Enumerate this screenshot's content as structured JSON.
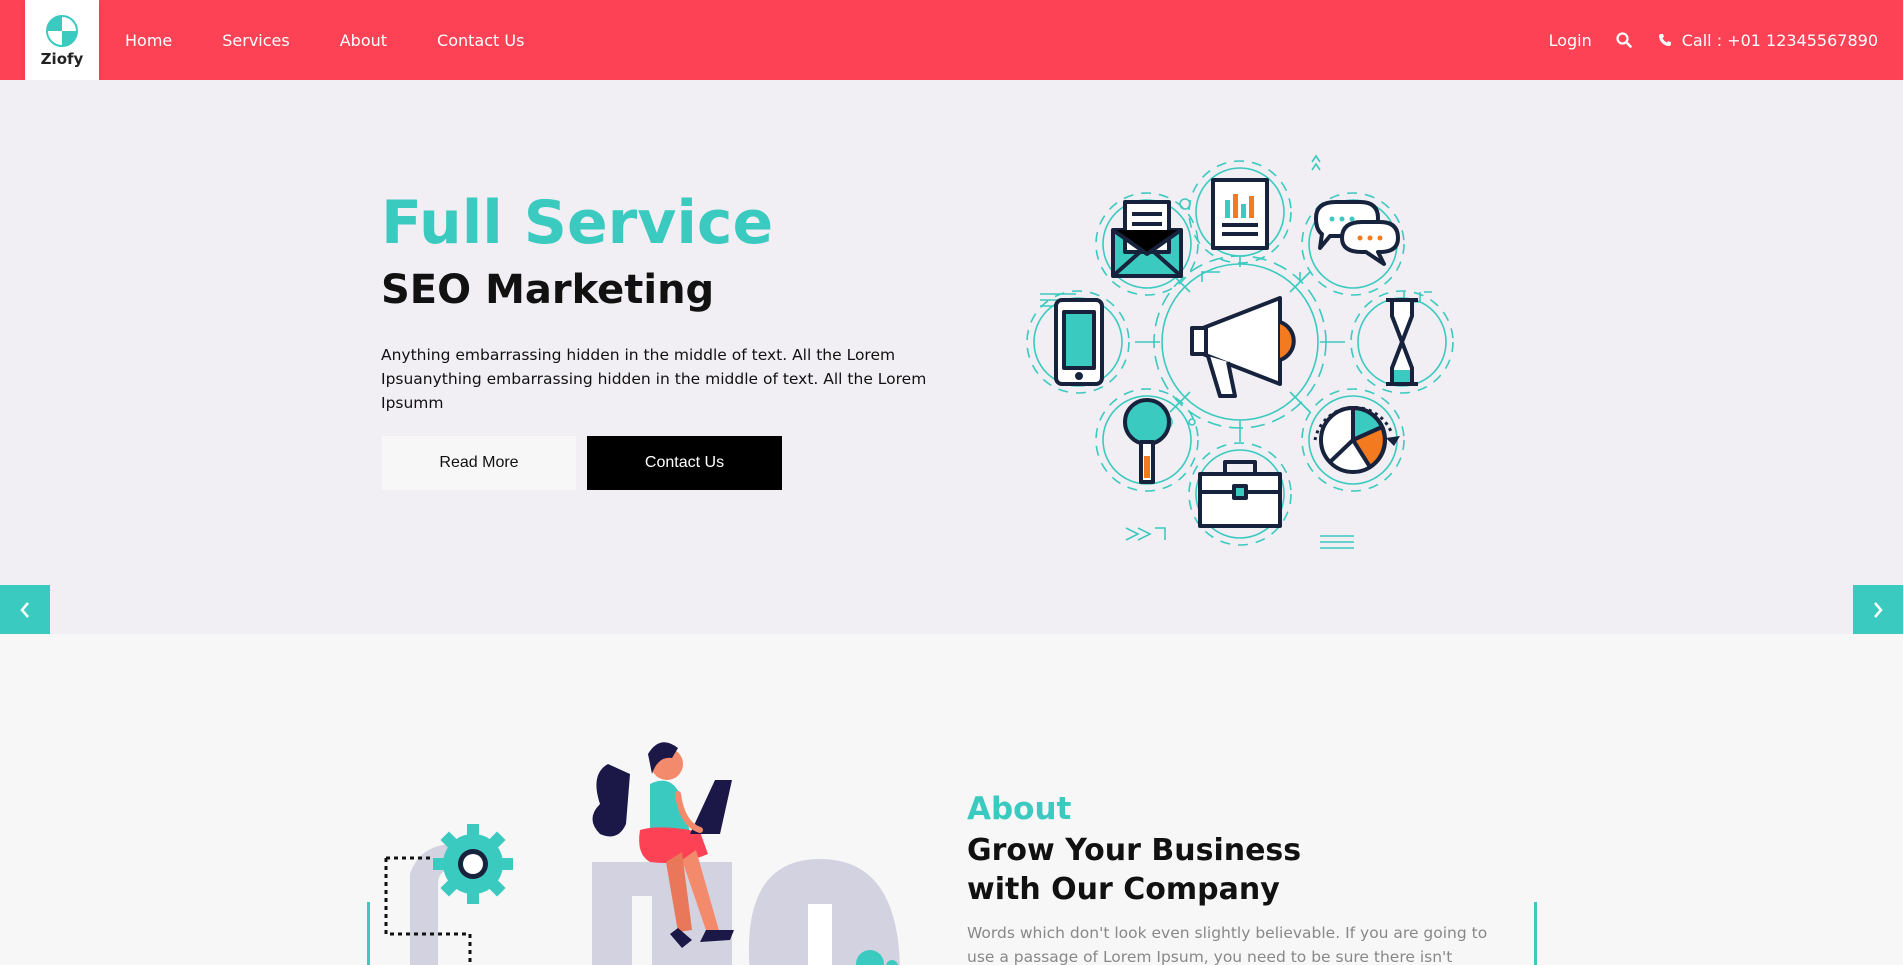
{
  "header": {
    "logo_text": "Ziofy",
    "nav": [
      "Home",
      "Services",
      "About",
      "Contact Us"
    ],
    "login": "Login",
    "call": "Call : +01 12345567890",
    "icons": [
      "search-icon",
      "phone-icon"
    ]
  },
  "hero": {
    "title": "Full Service",
    "subtitle": "SEO Marketing",
    "text": "Anything embarrassing hidden in the middle of text. All the Lorem Ipsuanything embarrassing hidden in the middle of text. All the Lorem Ipsumm",
    "read_more": "Read More",
    "contact_us": "Contact Us"
  },
  "about": {
    "label": "About",
    "title_line1": "Grow Your Business",
    "title_line2": "with Our Company",
    "text": "Words which don't look even slightly believable. If you are going to use a passage of Lorem Ipsum, you need to be sure there isn't anything"
  },
  "colors": {
    "primary_red": "#fe4256",
    "accent_teal": "#3bcac0",
    "dark": "#111111",
    "hero_bg": "#f1eff4",
    "page_bg": "#f7f7f7"
  }
}
